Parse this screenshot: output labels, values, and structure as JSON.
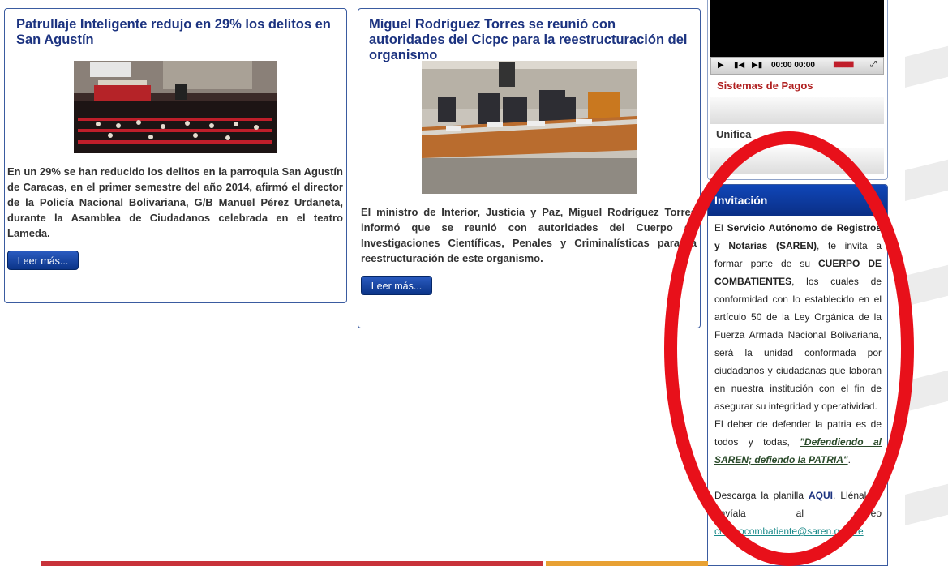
{
  "articles": [
    {
      "title": "Patrullaje Inteligente redujo en 29% los delitos en San Agustín",
      "body": "En un 29% se han reducido los delitos en la parroquia San Agustín de Caracas, en el primer semestre del año 2014, afirmó el director de la Policía Nacional Bolivariana, G/B Manuel Pérez Urdaneta, durante la Asamblea de Ciudadanos celebrada en el teatro Lameda.",
      "button": "Leer más..."
    },
    {
      "title": "Miguel Rodríguez Torres se reunió con autoridades del Cicpc para la reestructuración del organismo",
      "body": "El ministro de Interior, Justicia y Paz, Miguel Rodríguez Torres informó que se reunió con autoridades del Cuerpo de Investigaciones Científicas, Penales y Criminalísticas para la reestructuración de este organismo.",
      "button": "Leer más..."
    }
  ],
  "player": {
    "time": "00:00 00:00"
  },
  "sidebar": {
    "pagos": "Sistemas de Pagos",
    "unificado": "Unifica"
  },
  "invitacion": {
    "title": "Invitación",
    "p1_a": "El ",
    "p1_org": "Servicio Autónomo de Registros y Notarías (SAREN)",
    "p1_b": ", te invita a formar parte de su ",
    "p1_cuerpo": "CUERPO DE COMBATIENTES",
    "p1_c": ", los cuales de conformidad con lo establecido en el artículo 50 de la Ley Orgánica de la Fuerza Armada Nacional Bolivariana, será la unidad conformada por ciudadanos y ciudadanas que laboran en nuestra institución con el fin de asegurar su integridad y operatividad.",
    "p2_a": "El deber de defender la patria es de todos y todas, ",
    "p2_slogan": "\"Defendiendo al SAREN; defiendo la PATRIA\"",
    "p2_b": ".",
    "p3_a": "Descarga la planilla ",
    "p3_aqui": "AQUI",
    "p3_b": ". Llénala y envíala al correo ",
    "p3_mail": "cuerpocombatiente@saren.gob.ve"
  },
  "colors": {
    "accent": "#0b3488",
    "annotation": "#e8101a"
  }
}
